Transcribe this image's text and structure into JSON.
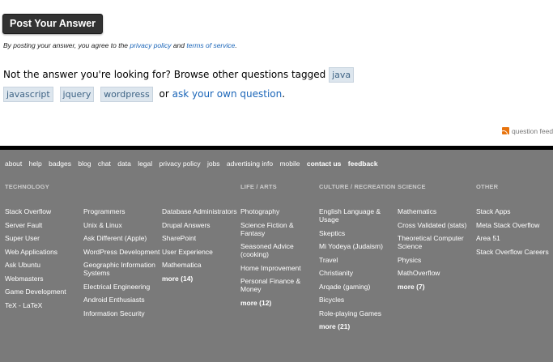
{
  "post_button": "Post Your Answer",
  "agree": {
    "prefix": "By posting your answer, you agree to the",
    "privacy": "privacy policy",
    "and": "and",
    "terms": "terms of service",
    "suffix": "."
  },
  "not_answer": {
    "text": "Not the answer you're looking for? Browse other questions tagged",
    "tags": [
      "java",
      "javascript",
      "jquery",
      "wordpress"
    ],
    "or": "or",
    "ask": "ask your own question",
    "end": "."
  },
  "feed_label": "question feed",
  "footer_links": [
    "about",
    "help",
    "badges",
    "blog",
    "chat",
    "data",
    "legal",
    "privacy policy",
    "jobs",
    "advertising info",
    "mobile",
    "contact us",
    "feedback"
  ],
  "columns": {
    "technology": {
      "head": "Technology",
      "items": [
        "Stack Overflow",
        "Server Fault",
        "Super User",
        "Web Applications",
        "Ask Ubuntu",
        "Webmasters",
        "Game Development",
        "TeX - LaTeX"
      ]
    },
    "technology2": {
      "items": [
        "Programmers",
        "Unix & Linux",
        "Ask Different (Apple)",
        "WordPress Development",
        "Geographic Information Systems",
        "Electrical Engineering",
        "Android Enthusiasts",
        "Information Security"
      ]
    },
    "technology3": {
      "items": [
        "Database Administrators",
        "Drupal Answers",
        "SharePoint",
        "User Experience",
        "Mathematica"
      ],
      "more": "more (14)"
    },
    "life": {
      "head": "Life / Arts",
      "items": [
        "Photography",
        "Science Fiction & Fantasy",
        "Seasoned Advice (cooking)",
        "Home Improvement",
        "Personal Finance & Money"
      ],
      "more": "more (12)"
    },
    "culture": {
      "head": "Culture / Recreation",
      "items": [
        "English Language & Usage",
        "Skeptics",
        "Mi Yodeya (Judaism)",
        "Travel",
        "Christianity",
        "Arqade (gaming)",
        "Bicycles",
        "Role-playing Games"
      ],
      "more": "more (21)"
    },
    "science": {
      "head": "Science",
      "items": [
        "Mathematics",
        "Cross Validated (stats)",
        "Theoretical Computer Science",
        "Physics",
        "MathOverflow"
      ],
      "more": "more (7)"
    },
    "other": {
      "head": "Other",
      "items": [
        "Stack Apps",
        "Meta Stack Overflow",
        "Area 51",
        "Stack Overflow Careers"
      ]
    }
  }
}
